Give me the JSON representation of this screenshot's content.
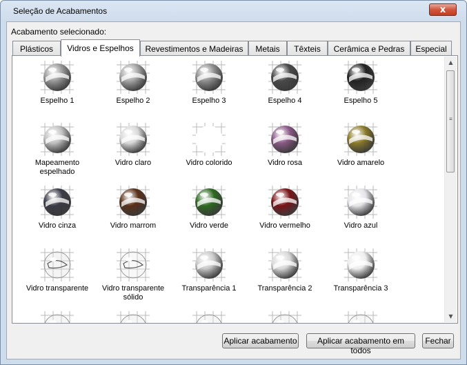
{
  "window": {
    "title": "Seleção de Acabamentos",
    "close_label": "x"
  },
  "selected_label": "Acabamento selecionado:",
  "tabs": [
    {
      "label": "Plásticos",
      "active": false
    },
    {
      "label": "Vidros e Espelhos",
      "active": true
    },
    {
      "label": "Revestimentos e Madeiras",
      "active": false
    },
    {
      "label": "Metais",
      "active": false
    },
    {
      "label": "Têxteis",
      "active": false
    },
    {
      "label": "Cerâmica e Pedras",
      "active": false
    },
    {
      "label": "Especial",
      "active": false
    }
  ],
  "materials": [
    {
      "label": "Espelho 1",
      "color": "#9a9a9a",
      "style": "mirror"
    },
    {
      "label": "Espelho 2",
      "color": "#a5a5a5",
      "style": "mirror"
    },
    {
      "label": "Espelho 3",
      "color": "#8f8f8f",
      "style": "mirror"
    },
    {
      "label": "Espelho 4",
      "color": "#4a4a4a",
      "style": "mirror"
    },
    {
      "label": "Espelho 5",
      "color": "#222222",
      "style": "mirror"
    },
    {
      "label": "Mapeamento espelhado",
      "color": "#c0c0c0",
      "style": "mirror"
    },
    {
      "label": "Vidro claro",
      "color": "#d8d8d8",
      "style": "glass"
    },
    {
      "label": "Vidro colorido",
      "color": "#fafafa",
      "style": "white"
    },
    {
      "label": "Vidro rosa",
      "color": "#8a5a86",
      "style": "glass"
    },
    {
      "label": "Vidro amarelo",
      "color": "#8a7a2a",
      "style": "glass"
    },
    {
      "label": "Vidro cinza",
      "color": "#3c3c48",
      "style": "glass"
    },
    {
      "label": "Vidro marrom",
      "color": "#5a3018",
      "style": "glass"
    },
    {
      "label": "Vidro verde",
      "color": "#2f6a22",
      "style": "glass"
    },
    {
      "label": "Vidro vermelho",
      "color": "#7a1418",
      "style": "glass"
    },
    {
      "label": "Vidro azul",
      "color": "#e4e4e8",
      "style": "glass"
    },
    {
      "label": "Vidro transparente",
      "color": "#e0e0e0",
      "style": "clear"
    },
    {
      "label": "Vidro transparente sólido",
      "color": "#ececec",
      "style": "clear"
    },
    {
      "label": "Transparência 1",
      "color": "#c8c8c8",
      "style": "glass"
    },
    {
      "label": "Transparência 2",
      "color": "#d8d8d8",
      "style": "glass"
    },
    {
      "label": "Transparência 3",
      "color": "#ededed",
      "style": "glass"
    },
    {
      "label": "",
      "color": "#e6e6e6",
      "style": "clear"
    },
    {
      "label": "",
      "color": "#e6e6e6",
      "style": "clear"
    },
    {
      "label": "",
      "color": "#e6e6e6",
      "style": "clear"
    },
    {
      "label": "",
      "color": "#e6e6e6",
      "style": "clear"
    },
    {
      "label": "",
      "color": "#e6e6e6",
      "style": "clear"
    }
  ],
  "buttons": {
    "apply": "Aplicar acabamento",
    "apply_all": "Aplicar acabamento em todos",
    "close": "Fechar"
  }
}
